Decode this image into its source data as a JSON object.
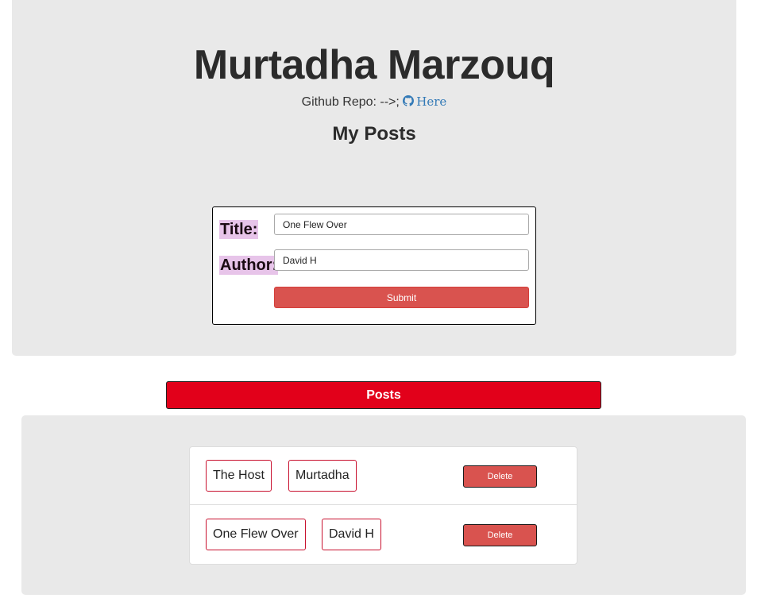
{
  "header": {
    "title": "Murtadha Marzouq",
    "repo_prefix": "Github Repo: -->; ",
    "repo_link_label": "Here",
    "section_heading": "My Posts"
  },
  "form": {
    "title_label": "Title:",
    "title_value": "One Flew Over",
    "author_label": "Author:",
    "author_value": "David H",
    "submit_label": "Submit"
  },
  "posts_banner": "Posts",
  "posts": [
    {
      "title": "The Host",
      "author": "Murtadha",
      "delete_label": "Delete"
    },
    {
      "title": "One Flew Over",
      "author": "David H",
      "delete_label": "Delete"
    }
  ],
  "icons": {
    "repo_icon": "github-icon"
  },
  "colors": {
    "accent_red": "#d9534f",
    "banner_red": "#e2001a",
    "chip_border": "#c8102e",
    "label_highlight": "#e7c4e9",
    "link_blue": "#337ab7",
    "panel_gray": "#e9e9e9"
  }
}
